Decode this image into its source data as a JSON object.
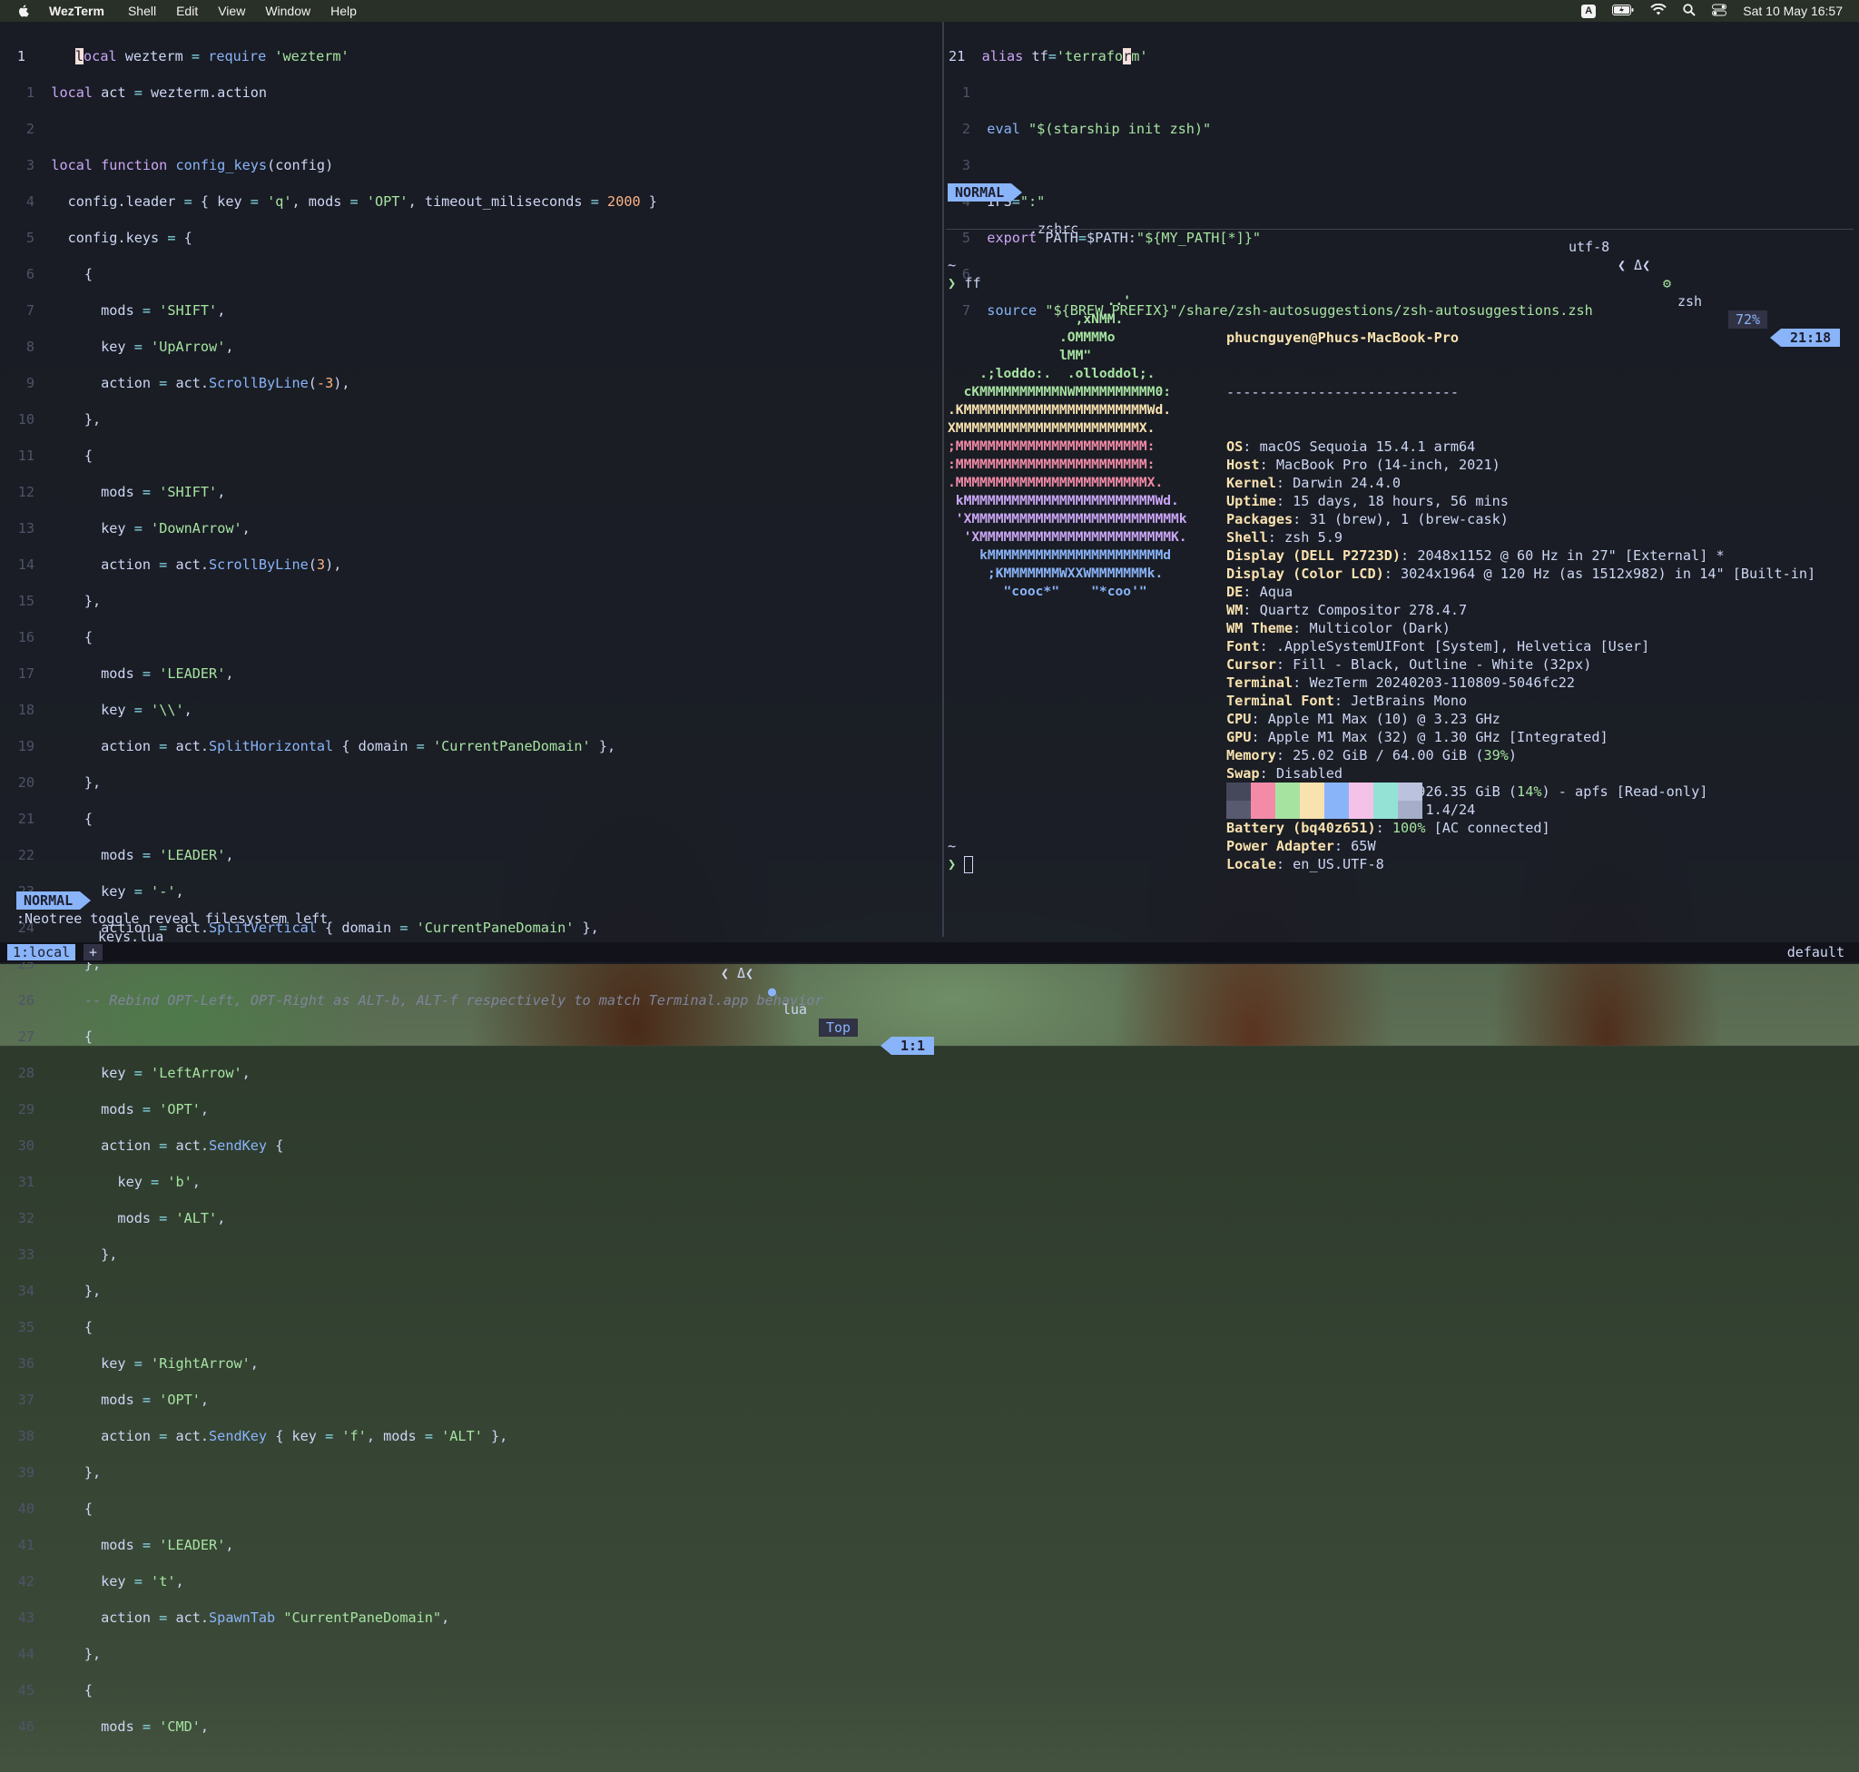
{
  "menubar": {
    "app_name": "WezTerm",
    "items": [
      "Shell",
      "Edit",
      "View",
      "Window",
      "Help"
    ],
    "input_badge": "A",
    "clock": "Sat 10 May  16:57"
  },
  "left_editor": {
    "lines": [
      "1",
      "1",
      "2",
      "3",
      "4",
      "5",
      "6",
      "7",
      "8",
      "9",
      "10",
      "11",
      "12",
      "13",
      "14",
      "15",
      "16",
      "17",
      "18",
      "19",
      "20",
      "21",
      "22",
      "23",
      "24",
      "25",
      "26",
      "27",
      "28",
      "29",
      "30",
      "31",
      "32",
      "33",
      "34",
      "35",
      "36",
      "37",
      "38",
      "39",
      "40",
      "41",
      "42",
      "43",
      "44",
      "45",
      "46"
    ],
    "status": {
      "mode": "NORMAL",
      "filename": "keys.lua",
      "encoding": "utf-8",
      "filetype": "lua",
      "scroll": "Top",
      "position": "1:1"
    },
    "cmdline": ":Neotree toggle reveal filesystem left"
  },
  "right_editor": {
    "status": {
      "mode": "NORMAL",
      "filename": ".zshrc",
      "encoding": "utf-8",
      "filetype": "zsh",
      "scroll": "72%",
      "position": "21:18"
    }
  },
  "terminal": {
    "prompt_dir": "~",
    "prompt_cmd": "ff",
    "prompt_dir2": "~",
    "user_host": "phucnguyen@Phucs-MacBook-Pro",
    "separator": "----------------------------",
    "info": [
      {
        "k": "OS",
        "v": ": macOS Sequoia 15.4.1 arm64"
      },
      {
        "k": "Host",
        "v": ": MacBook Pro (14-inch, 2021)"
      },
      {
        "k": "Kernel",
        "v": ": Darwin 24.4.0"
      },
      {
        "k": "Uptime",
        "v": ": 15 days, 18 hours, 56 mins"
      },
      {
        "k": "Packages",
        "v": ": 31 (brew), 1 (brew-cask)"
      },
      {
        "k": "Shell",
        "v": ": zsh 5.9"
      },
      {
        "k": "Display (DELL P2723D)",
        "v": ": 2048x1152 @ 60 Hz in 27\" [External] *"
      },
      {
        "k": "Display (Color LCD)",
        "v": ": 3024x1964 @ 120 Hz (as 1512x982) in 14\" [Built-in]"
      },
      {
        "k": "DE",
        "v": ": Aqua"
      },
      {
        "k": "WM",
        "v": ": Quartz Compositor 278.4.7"
      },
      {
        "k": "WM Theme",
        "v": ": Multicolor (Dark)"
      },
      {
        "k": "Font",
        "v": ": .AppleSystemUIFont [System], Helvetica [User]"
      },
      {
        "k": "Cursor",
        "v": ": Fill - Black, Outline - White (32px)"
      },
      {
        "k": "Terminal",
        "v": ": WezTerm 20240203-110809-5046fc22"
      },
      {
        "k": "Terminal Font",
        "v": ": JetBrains Mono"
      },
      {
        "k": "CPU",
        "v": ": Apple M1 Max (10) @ 3.23 GHz"
      },
      {
        "k": "GPU",
        "v": ": Apple M1 Max (32) @ 1.30 GHz [Integrated]"
      },
      {
        "k": "Memory",
        "v": ": 25.02 GiB / 64.00 GiB (",
        "p": "39%",
        "e": ")"
      },
      {
        "k": "Swap",
        "v": ": Disabled"
      },
      {
        "k": "Disk (/)",
        "v": ": 129.36 GiB / 926.35 GiB (",
        "p": "14%",
        "e": ") - apfs [Read-only]"
      },
      {
        "k": "Local IP (en0)",
        "v": ": 192.168.1.4/24"
      },
      {
        "k": "Battery (bq40z651)",
        "v": ": ",
        "p": "100%",
        "e": " [AC connected]"
      },
      {
        "k": "Power Adapter",
        "v": ": 65W"
      },
      {
        "k": "Locale",
        "v": ": en_US.UTF-8"
      }
    ],
    "logo": [
      "                    ..'",
      "                ,xNMM.",
      "              .OMMMMo",
      "              lMM\"",
      "    .;loddo:.  .olloddol;.",
      "  cKMMMMMMMMMMNWMMMMMMMMMM0:",
      ".KMMMMMMMMMMMMMMMMMMMMMMMWd.",
      "XMMMMMMMMMMMMMMMMMMMMMMMX.",
      ";MMMMMMMMMMMMMMMMMMMMMMMM:",
      ":MMMMMMMMMMMMMMMMMMMMMMMM:",
      ".MMMMMMMMMMMMMMMMMMMMMMMMX.",
      " kMMMMMMMMMMMMMMMMMMMMMMMMWd.",
      " 'XMMMMMMMMMMMMMMMMMMMMMMMMMMk",
      "  'XMMMMMMMMMMMMMMMMMMMMMMMMK.",
      "    kMMMMMMMMMMMMMMMMMMMMMMd",
      "     ;KMMMMMMMWXXWMMMMMMMk.",
      "       \"cooc*\"    \"*coo'\""
    ],
    "logo_colors": [
      "#a6e3a1",
      "#a6e3a1",
      "#a6e3a1",
      "#a6e3a1",
      "#a6e3a1",
      "#a6e3a1",
      "#f9e2af",
      "#f9e2af",
      "#f38ba8",
      "#f38ba8",
      "#f38ba8",
      "#cba6f7",
      "#cba6f7",
      "#cba6f7",
      "#89b4fa",
      "#89b4fa",
      "#89b4fa"
    ],
    "palette_top": [
      "#45475a",
      "#f38ba8",
      "#a6e3a1",
      "#f9e2af",
      "#89b4fa",
      "#f5c2e7",
      "#94e2d5",
      "#bac2de"
    ],
    "palette_bot": [
      "#585b70",
      "#f38ba8",
      "#a6e3a1",
      "#f9e2af",
      "#89b4fa",
      "#f5c2e7",
      "#94e2d5",
      "#a6adc8"
    ]
  },
  "tabbar": {
    "active_tab": "1:local",
    "add_tab": "+",
    "workspace": "default"
  },
  "colors": {
    "accent": "#89b4fa",
    "string": "#a6e3a1",
    "keyword": "#cba6f7",
    "number": "#fab387"
  }
}
